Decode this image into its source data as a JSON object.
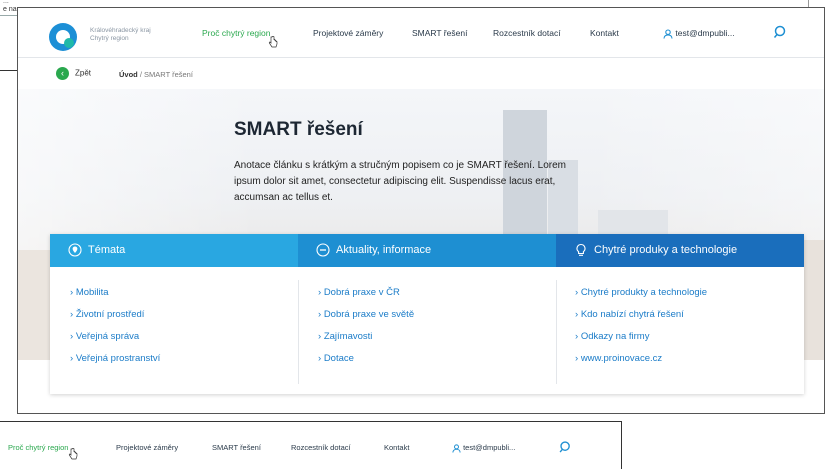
{
  "background": {
    "top_line1": "...",
    "top_line2": "e na"
  },
  "brand": {
    "line1": "Královéhradecký kraj",
    "line2": "Chytrý region"
  },
  "nav": {
    "items": [
      {
        "label": "Proč chytrý region",
        "active": true
      },
      {
        "label": "Projektové záměry"
      },
      {
        "label": "SMART řešení"
      },
      {
        "label": "Rozcestník dotací"
      },
      {
        "label": "Kontakt"
      }
    ],
    "user": "test@dmpubli...",
    "icons": {
      "user": "user-icon",
      "search": "search-icon"
    }
  },
  "breadcrumb": {
    "back_label": "Zpět",
    "home": "Úvod",
    "separator": "/",
    "current": "SMART řešení"
  },
  "hero": {
    "title": "SMART řešení",
    "intro": "Anotace článku s krátkým a stručným popisem co je SMART řešení. Lorem ipsum dolor sit amet, consectetur adipiscing elit. Suspendisse lacus erat, accumsan ac tellus et."
  },
  "cards": [
    {
      "title": "Témata",
      "icon": "location-pin-icon",
      "links": [
        "Mobilita",
        "Životní prostředí",
        "Veřejná správa",
        "Veřejná prostranství"
      ]
    },
    {
      "title": "Aktuality, informace",
      "icon": "minus-circle-icon",
      "links": [
        "Dobrá praxe v ČR",
        "Dobrá praxe ve světě",
        "Zajímavosti",
        "Dotace"
      ]
    },
    {
      "title": "Chytré produky a technologie",
      "icon": "lightbulb-icon",
      "links": [
        "Chytré produkty a technologie",
        "Kdo nabízí chytrá řešení",
        "Odkazy na firmy",
        "www.proinovace.cz"
      ]
    }
  ],
  "colors": {
    "accent_green": "#2aa84e",
    "blue_light": "#29a7e1",
    "blue_mid": "#1e8fd2",
    "blue_dark": "#1a6ebc"
  }
}
